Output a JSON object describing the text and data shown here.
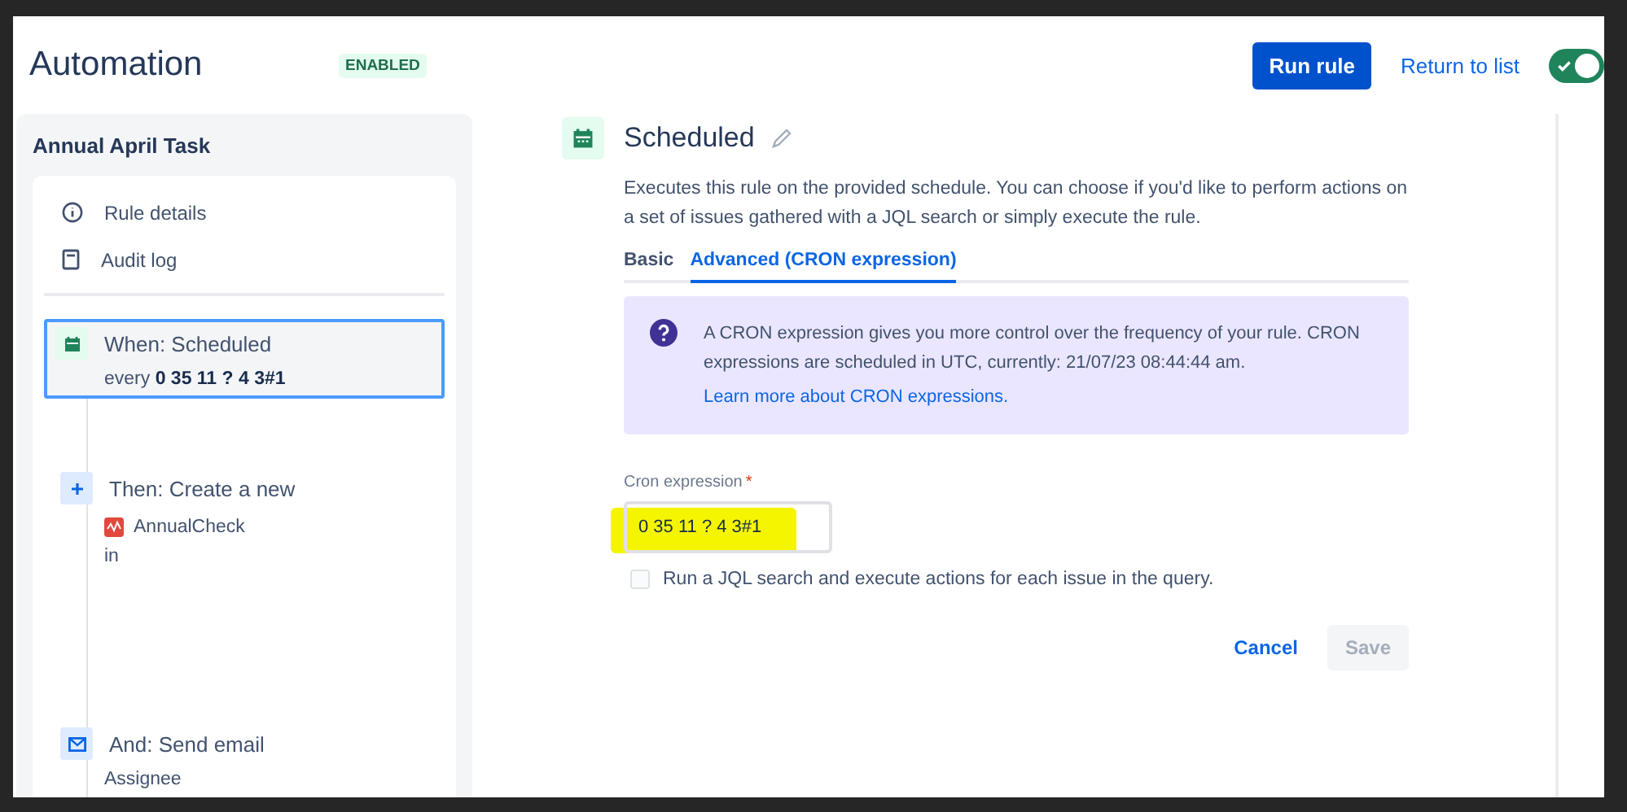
{
  "header": {
    "title": "Automation",
    "status": "ENABLED",
    "run_button": "Run rule",
    "return_link": "Return to list",
    "enabled_toggle": {
      "on": true
    }
  },
  "sidebar": {
    "rule_name": "Annual April Task",
    "links": [
      {
        "label": "Rule details",
        "kind": "info"
      },
      {
        "label": "Audit log",
        "kind": "log"
      }
    ],
    "steps": [
      {
        "kind": "trigger",
        "title": "When: Scheduled",
        "selected": true,
        "detail_prefix": "every",
        "detail_bold": "0 35 11 ? 4 3#1"
      },
      {
        "kind": "action",
        "title": "Then: Create a new",
        "selected": false,
        "issue_type": "AnnualCheck",
        "detail": "in"
      },
      {
        "kind": "email",
        "title": "And: Send email",
        "selected": false,
        "detail": "Assignee"
      }
    ]
  },
  "panel": {
    "title": "Scheduled",
    "description": "Executes this rule on the provided schedule. You can choose if you'd like to perform actions on a set of issues gathered with a JQL search or simply execute the rule.",
    "tabs": [
      {
        "label": "Basic",
        "selected": false
      },
      {
        "label": "Advanced (CRON expression)",
        "selected": true
      }
    ],
    "info": {
      "text": "A CRON expression gives you more control over the frequency of your rule. CRON expressions are scheduled in UTC, currently: 21/07/23 08:44:44 am.",
      "link": "Learn more about CRON expressions."
    },
    "cron_field": {
      "label": "Cron expression",
      "required_mark": "*",
      "value": "0 35 11 ? 4 3#1",
      "highlighted": true
    },
    "jql_checkbox": {
      "label": "Run a JQL search and execute actions for each issue in the query.",
      "checked": false
    },
    "cancel": "Cancel",
    "save": {
      "label": "Save",
      "disabled": true
    }
  }
}
